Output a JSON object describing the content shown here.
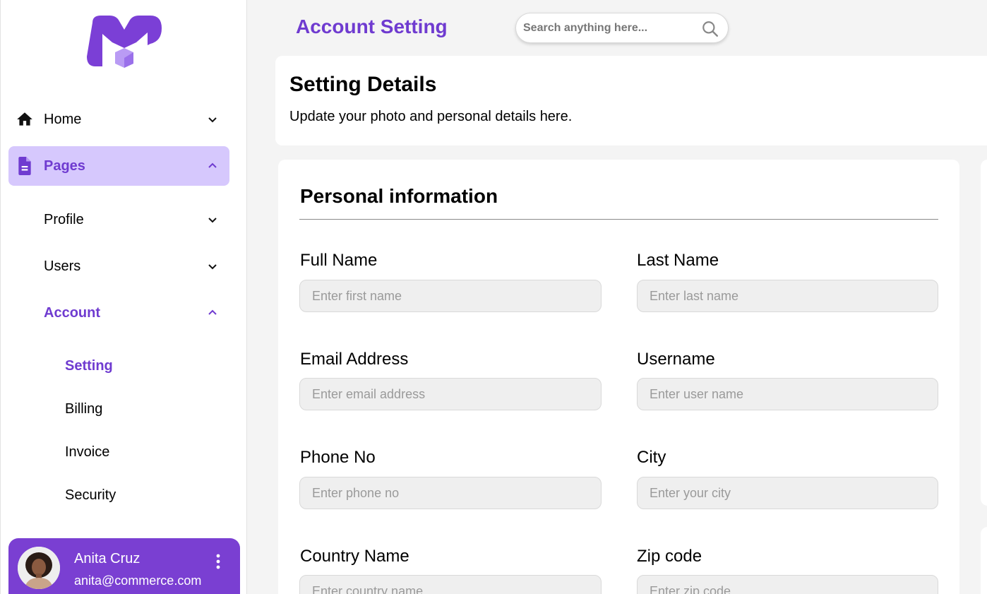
{
  "header": {
    "title": "Account Setting",
    "search_placeholder": "Search anything here..."
  },
  "sidebar": {
    "items": [
      {
        "label": "Home",
        "icon": "home-icon"
      },
      {
        "label": "Pages",
        "icon": "document-icon"
      },
      {
        "label": "Profile"
      },
      {
        "label": "Users"
      },
      {
        "label": "Account"
      }
    ],
    "account_subitems": [
      {
        "label": "Setting"
      },
      {
        "label": "Billing"
      },
      {
        "label": "Invoice"
      },
      {
        "label": "Security"
      }
    ],
    "user": {
      "name": "Anita Cruz",
      "email": "anita@commerce.com"
    }
  },
  "details": {
    "title": "Setting Details",
    "subtitle": "Update your photo and personal details here."
  },
  "personal_info": {
    "title": "Personal information",
    "fields": [
      {
        "label": "Full Name",
        "placeholder": "Enter first name"
      },
      {
        "label": "Last Name",
        "placeholder": "Enter last name"
      },
      {
        "label": "Email Address",
        "placeholder": "Enter email address"
      },
      {
        "label": "Username",
        "placeholder": "Enter user name"
      },
      {
        "label": "Phone No",
        "placeholder": "Enter phone no"
      },
      {
        "label": "City",
        "placeholder": "Enter your city"
      },
      {
        "label": "Country Name",
        "placeholder": "Enter country name"
      },
      {
        "label": "Zip code",
        "placeholder": "Enter zip code"
      }
    ]
  },
  "colors": {
    "accent": "#6f3bd0",
    "accent_light": "#d6c8fd",
    "user_card": "#7a3fd2",
    "background": "#f4f4f4"
  }
}
